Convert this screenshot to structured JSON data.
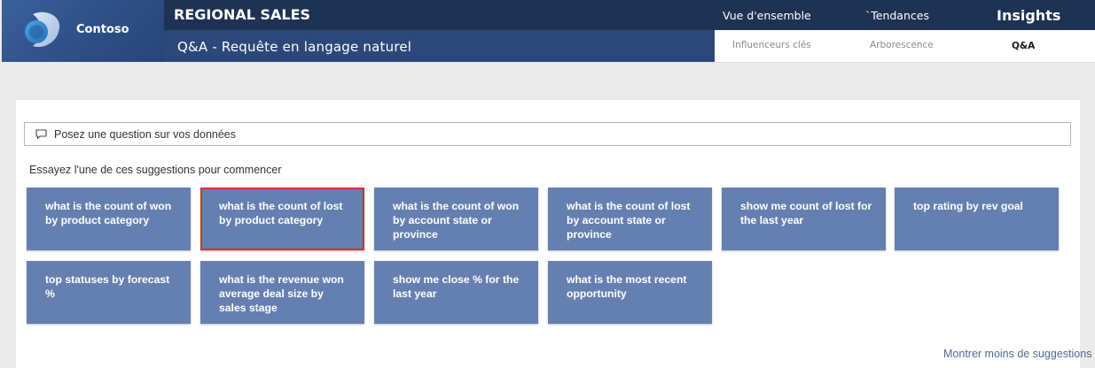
{
  "brand": {
    "name": "Contoso"
  },
  "header": {
    "report_title": "REGIONAL SALES",
    "page_subtitle": "Q&A - Requête en langage naturel"
  },
  "nav": {
    "main": [
      "Vue d'ensemble",
      "`Tendances",
      "Insights"
    ],
    "active_main": "Insights",
    "sub": [
      "Influenceurs clés",
      "Arborescence",
      "Q&A"
    ],
    "active_sub": "Q&A"
  },
  "qa": {
    "placeholder": "Posez une question sur vos données",
    "suggestions_label": "Essayez l'une de ces suggestions pour commencer",
    "suggestions": [
      "what is the count of won by product category",
      "what is the count of lost by product category",
      "what is the count of won by account state or province",
      "what is the count of lost by account state or province",
      "show me count of lost for the last year",
      "top rating by rev goal",
      "top statuses by forecast %",
      "what is the revenue won average deal size by sales stage",
      "show me close % for the last year",
      "what is the most recent opportunity"
    ],
    "selected_suggestion": "what is the count of lost by product category",
    "show_less_label": "Montrer moins de suggestions"
  },
  "colors": {
    "tile": "#6580b0",
    "selected_border": "#d62f3b",
    "header_dark": "#1e3254",
    "header_mid": "#2c4878"
  }
}
